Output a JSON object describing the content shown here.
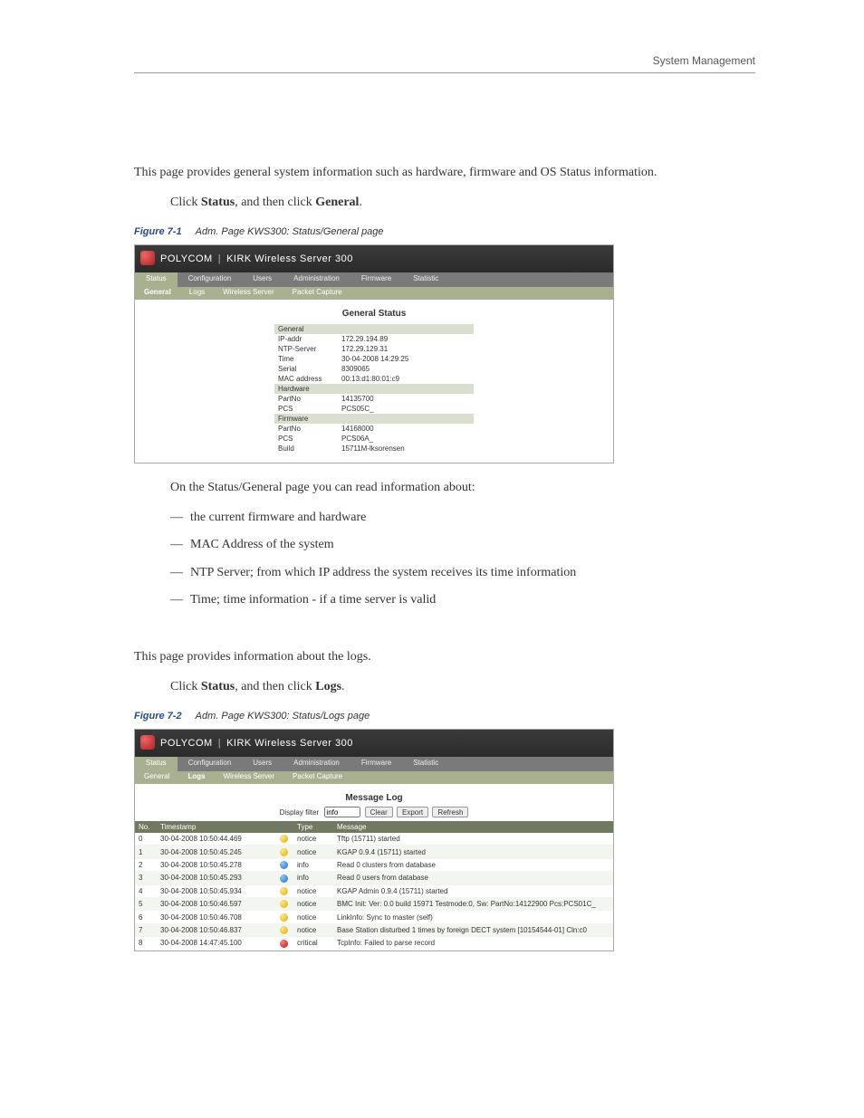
{
  "page_header": "System Management",
  "section1": {
    "intro": "This page provides general system information such as hardware, firmware and OS Status information.",
    "step_prefix": "Click ",
    "step_bold1": "Status",
    "step_mid": ", and then click ",
    "step_bold2": "General",
    "step_suffix": ".",
    "fig_num": "Figure 7-1",
    "fig_title": "Adm. Page KWS300: Status/General page",
    "after_fig_intro": "On the Status/General page you can read information about:",
    "bullets": [
      "the current firmware and hardware",
      "MAC Address of the system",
      "NTP Server; from which IP address the system receives its time information",
      "Time; time information - if a time server is valid"
    ]
  },
  "section2": {
    "intro": "This page provides information about the logs.",
    "step_prefix": "Click ",
    "step_bold1": "Status",
    "step_mid": ", and then click ",
    "step_bold2": "Logs",
    "step_suffix": ".",
    "fig_num": "Figure 7-2",
    "fig_title": "Adm. Page KWS300: Status/Logs page"
  },
  "screenshot": {
    "brand1": "POLYCOM",
    "brand2": "KIRK Wireless Server 300",
    "top_tabs": [
      "Status",
      "Configuration",
      "Users",
      "Administration",
      "Firmware",
      "Statistic"
    ],
    "sub_tabs": [
      "General",
      "Logs",
      "Wireless Server",
      "Packet Capture"
    ]
  },
  "general_status": {
    "title": "General Status",
    "sections": [
      {
        "section": "General",
        "rows": [
          {
            "k": "IP-addr",
            "v": "172.29.194.89"
          },
          {
            "k": "NTP-Server",
            "v": "172.29.129.31"
          },
          {
            "k": "Time",
            "v": "30-04-2008 14:29:25"
          },
          {
            "k": "Serial",
            "v": "8309065"
          },
          {
            "k": "MAC address",
            "v": "00:13:d1:80:01:c9"
          }
        ]
      },
      {
        "section": "Hardware",
        "rows": [
          {
            "k": "PartNo",
            "v": "14135700"
          },
          {
            "k": "PCS",
            "v": "PCS05C_"
          }
        ]
      },
      {
        "section": "Firmware",
        "rows": [
          {
            "k": "PartNo",
            "v": "14168000"
          },
          {
            "k": "PCS",
            "v": "PCS06A_"
          },
          {
            "k": "Build",
            "v": "15711M-lksorensen"
          }
        ]
      }
    ]
  },
  "message_log": {
    "title": "Message Log",
    "filter_label": "Display filter",
    "filter_value": "info",
    "buttons": [
      "Clear",
      "Export",
      "Refresh"
    ],
    "columns": [
      "No.",
      "Timestamp",
      "",
      "Type",
      "Message"
    ],
    "rows": [
      {
        "no": "0",
        "ts": "30-04-2008 10:50:44.469",
        "lvl": "notice",
        "msg": "Tftp (15711) started"
      },
      {
        "no": "1",
        "ts": "30-04-2008 10:50:45.245",
        "lvl": "notice",
        "msg": "KGAP 0.9.4 (15711) started"
      },
      {
        "no": "2",
        "ts": "30-04-2008 10:50:45.278",
        "lvl": "info",
        "msg": "Read 0 clusters from database"
      },
      {
        "no": "3",
        "ts": "30-04-2008 10:50:45.293",
        "lvl": "info",
        "msg": "Read 0 users from database"
      },
      {
        "no": "4",
        "ts": "30-04-2008 10:50:45.934",
        "lvl": "notice",
        "msg": "KGAP Admin 0.9.4 (15711) started"
      },
      {
        "no": "5",
        "ts": "30-04-2008 10:50:46.597",
        "lvl": "notice",
        "msg": "BMC Init: Ver: 0.0 build 15971 Testmode:0, Sw: PartNo:14122900 Pcs:PCS01C_"
      },
      {
        "no": "6",
        "ts": "30-04-2008 10:50:46.708",
        "lvl": "notice",
        "msg": "LinkInfo: Sync to master (self)"
      },
      {
        "no": "7",
        "ts": "30-04-2008 10:50:46.837",
        "lvl": "notice",
        "msg": "Base Station disturbed 1 times by foreign DECT system [10154544-01] Cln:c0"
      },
      {
        "no": "8",
        "ts": "30-04-2008 14:47:45.100",
        "lvl": "critical",
        "msg": "TcpInfo: Failed to parse record"
      }
    ]
  }
}
